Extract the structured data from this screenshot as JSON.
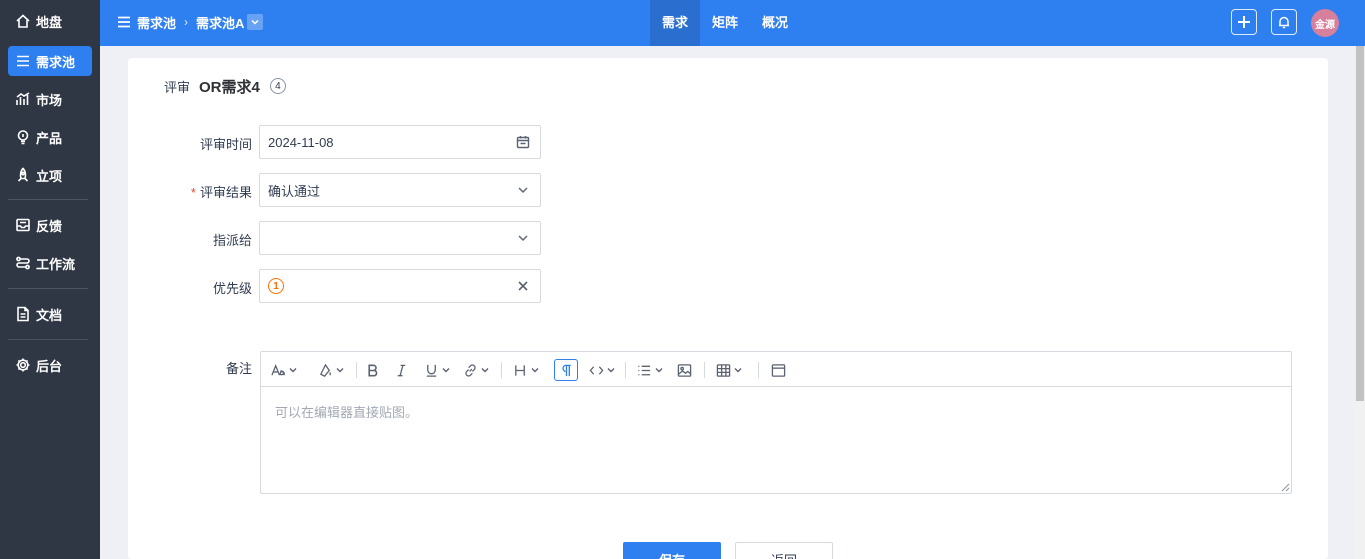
{
  "sidebar": {
    "items": [
      {
        "label": "地盘",
        "icon": "home-icon"
      },
      {
        "label": "需求池",
        "icon": "list-icon",
        "active": true
      },
      {
        "label": "市场",
        "icon": "chart-icon"
      },
      {
        "label": "产品",
        "icon": "bulb-icon"
      },
      {
        "label": "立项",
        "icon": "rocket-icon"
      },
      {
        "label": "反馈",
        "icon": "inbox-icon"
      },
      {
        "label": "工作流",
        "icon": "workflow-icon"
      },
      {
        "label": "文档",
        "icon": "document-icon"
      },
      {
        "label": "后台",
        "icon": "gear-icon"
      }
    ]
  },
  "topbar": {
    "breadcrumb": [
      "需求池",
      "需求池A"
    ],
    "tabs": [
      {
        "label": "需求",
        "active": true
      },
      {
        "label": "矩阵"
      },
      {
        "label": "概况"
      }
    ],
    "avatar_text": "金源"
  },
  "page": {
    "title_prefix": "评审",
    "title": "OR需求4",
    "badge": "4"
  },
  "form": {
    "review_time_label": "评审时间",
    "review_time_value": "2024-11-08",
    "review_result_label": "评审结果",
    "review_result_value": "确认通过",
    "assign_label": "指派给",
    "assign_value": "",
    "priority_label": "优先级",
    "priority_value": "1",
    "notes_label": "备注",
    "notes_placeholder": "可以在编辑器直接贴图。"
  },
  "buttons": {
    "save": "保存",
    "back": "返回"
  },
  "colors": {
    "accent": "#2e7ff0",
    "sidebar_bg": "#2f3744",
    "priority": "#ff6f00",
    "required": "#e64a3b"
  }
}
